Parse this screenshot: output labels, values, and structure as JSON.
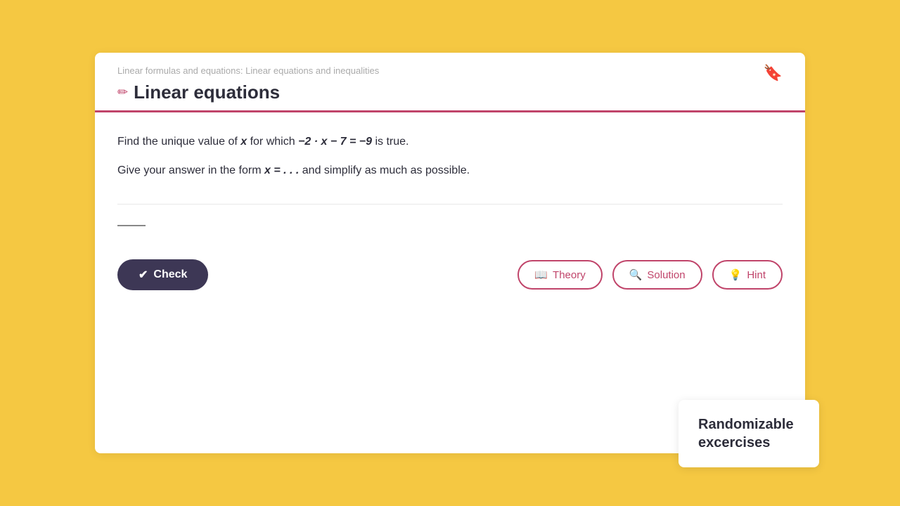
{
  "breadcrumb": {
    "text": "Linear formulas and equations: Linear equations and inequalities"
  },
  "header": {
    "title": "Linear equations",
    "pencil_icon": "✏",
    "bookmark_icon": "🔖"
  },
  "problem": {
    "line1_prefix": "Find the unique value of ",
    "line1_var": "x",
    "line1_middle": " for which ",
    "line1_equation": "−2 · x − 7 = −9",
    "line1_suffix": " is true.",
    "line2_prefix": "Give your answer in the form ",
    "line2_form": "x = . . .",
    "line2_suffix": " and simplify as much as possible."
  },
  "buttons": {
    "check_label": "Check",
    "theory_label": "Theory",
    "solution_label": "Solution",
    "hint_label": "Hint"
  },
  "sidebar": {
    "randomizable_line1": "Randomizable",
    "randomizable_line2": "excercises"
  },
  "icons": {
    "check": "✔",
    "theory": "📖",
    "solution": "🔍",
    "hint": "💡"
  }
}
